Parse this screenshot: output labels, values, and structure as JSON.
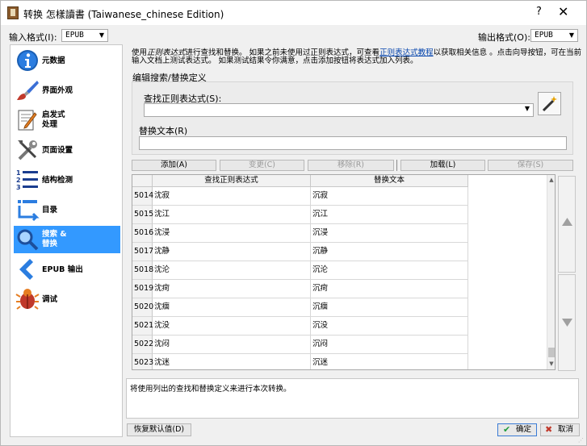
{
  "window": {
    "title": "转换 怎樣讀書 (Taiwanese_chinese Edition)",
    "help_icon": "?",
    "close_icon": "✕"
  },
  "input_format": {
    "label": "输入格式(I):",
    "value": "EPUB"
  },
  "output_format": {
    "label": "输出格式(O):",
    "value": "EPUB"
  },
  "sidebar": {
    "items": [
      {
        "label": "元数据",
        "icon": "info-icon"
      },
      {
        "label": "界面外观",
        "icon": "paintbrush-icon"
      },
      {
        "label": "启发式\n处理",
        "icon": "document-pencil-icon"
      },
      {
        "label": "页面设置",
        "icon": "tools-icon"
      },
      {
        "label": "结构检测",
        "icon": "numbered-list-icon"
      },
      {
        "label": "目录",
        "icon": "toc-icon"
      },
      {
        "label": "搜索 &\n替换",
        "icon": "magnifier-icon",
        "selected": true
      },
      {
        "label": "EPUB 输出",
        "icon": "arrow-left-icon"
      },
      {
        "label": "调试",
        "icon": "bug-icon"
      }
    ]
  },
  "description": {
    "part1": "使用",
    "italic": "正则表达式",
    "part2": "进行查找和替换。 如果之前未使用过正则表达式，可查看",
    "link": "正则表达式教程",
    "part3": "以获取相关信息 。点击向导按钮，可在当前输入文档上测试表达式。 如果测试结果令你满意，点击添加按钮将表达式加入列表。"
  },
  "editor": {
    "group_title": "编辑搜索/替换定义",
    "find_label": "查找正则表达式(S):",
    "find_value": "",
    "replace_label": "替换文本(R)",
    "replace_value": ""
  },
  "buttons": {
    "add": "添加(A)",
    "change": "变更(C)",
    "remove": "移除(R)",
    "load": "加载(L)",
    "save": "保存(S)"
  },
  "table": {
    "headers": [
      "查找正则表达式",
      "替换文本"
    ],
    "rows": [
      {
        "n": "5014",
        "find": "沈寂",
        "replace": "沉寂"
      },
      {
        "n": "5015",
        "find": "沈江",
        "replace": "沉江"
      },
      {
        "n": "5016",
        "find": "沈浸",
        "replace": "沉浸"
      },
      {
        "n": "5017",
        "find": "沈静",
        "replace": "沉静"
      },
      {
        "n": "5018",
        "find": "沈沦",
        "replace": "沉沦"
      },
      {
        "n": "5019",
        "find": "沈疴",
        "replace": "沉疴"
      },
      {
        "n": "5020",
        "find": "沈痼",
        "replace": "沉痼"
      },
      {
        "n": "5021",
        "find": "沈没",
        "replace": "沉没"
      },
      {
        "n": "5022",
        "find": "沈闷",
        "replace": "沉闷"
      },
      {
        "n": "5023",
        "find": "沈迷",
        "replace": "沉迷"
      }
    ]
  },
  "result_text": "将使用列出的查找和替换定义来进行本次转换。",
  "footer": {
    "reset": "恢复默认值(D)",
    "ok": "确定",
    "cancel": "取消"
  },
  "colors": {
    "selection": "#3399ff",
    "link": "#0645ad"
  }
}
